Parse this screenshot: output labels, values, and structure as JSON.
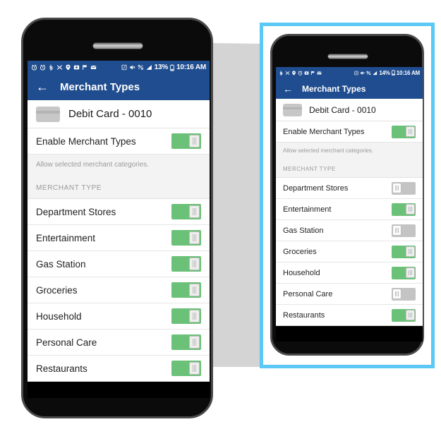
{
  "scene": {
    "callout_border_color": "#5BC8F5",
    "callout_wedge_color": "#D4D4D4",
    "accent_header_color": "#1F4D8F",
    "toggle_on_color": "#6CC178",
    "toggle_off_color": "#C4C4C4"
  },
  "phone_large": {
    "status_bar": {
      "left_icons": [
        "alarm-icon",
        "alarm-icon",
        "bluetooth-share-icon",
        "sync-icon",
        "location-icon",
        "screenshot-icon",
        "flag-icon",
        "mail-icon"
      ],
      "right_icons": [
        "nfc-icon",
        "mute-icon",
        "data-saver-icon",
        "signal-icon"
      ],
      "battery_percent": "13%",
      "battery_icon": "battery-icon",
      "clock": "10:16 AM"
    },
    "app_bar": {
      "back_icon": "back-arrow-icon",
      "title": "Merchant Types"
    },
    "card": {
      "icon": "credit-card-icon",
      "label": "Debit Card - 0010"
    },
    "master_toggle": {
      "label": "Enable Merchant Types",
      "state": "on"
    },
    "helper_text": "Allow selected merchant categories.",
    "section_header": "MERCHANT TYPE",
    "items": [
      {
        "label": "Department Stores",
        "state": "on"
      },
      {
        "label": "Entertainment",
        "state": "on"
      },
      {
        "label": "Gas Station",
        "state": "on"
      },
      {
        "label": "Groceries",
        "state": "on"
      },
      {
        "label": "Household",
        "state": "on"
      },
      {
        "label": "Personal Care",
        "state": "on"
      },
      {
        "label": "Restaurants",
        "state": "on"
      }
    ]
  },
  "phone_small": {
    "status_bar": {
      "left_icons": [
        "bluetooth-share-icon",
        "sync-icon",
        "location-icon",
        "alarm-icon",
        "screenshot-icon",
        "flag-icon",
        "mail-icon"
      ],
      "right_icons": [
        "nfc-icon",
        "mute-icon",
        "data-saver-icon",
        "signal-icon"
      ],
      "battery_percent": "14%",
      "battery_icon": "battery-icon",
      "clock": "10:16 AM"
    },
    "app_bar": {
      "back_icon": "back-arrow-icon",
      "title": "Merchant Types"
    },
    "card": {
      "icon": "credit-card-icon",
      "label": "Debit Card - 0010"
    },
    "master_toggle": {
      "label": "Enable Merchant Types",
      "state": "on"
    },
    "helper_text": "Allow selected merchant categories.",
    "section_header": "MERCHANT TYPE",
    "items": [
      {
        "label": "Department Stores",
        "state": "off"
      },
      {
        "label": "Entertainment",
        "state": "on"
      },
      {
        "label": "Gas Station",
        "state": "off"
      },
      {
        "label": "Groceries",
        "state": "on"
      },
      {
        "label": "Household",
        "state": "on"
      },
      {
        "label": "Personal Care",
        "state": "off"
      },
      {
        "label": "Restaurants",
        "state": "on"
      }
    ]
  }
}
